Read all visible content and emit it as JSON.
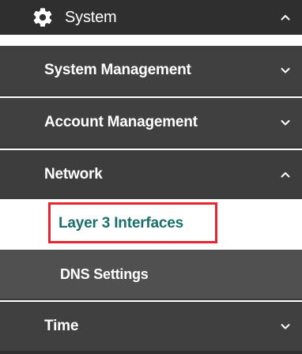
{
  "menu": {
    "system": {
      "label": "System",
      "icon": "gear-icon",
      "expanded": true
    },
    "items": [
      {
        "label": "System Management",
        "expanded": false
      },
      {
        "label": "Account Management",
        "expanded": false
      },
      {
        "label": "Network",
        "expanded": true
      },
      {
        "label": "Time",
        "expanded": false
      }
    ],
    "network_children": [
      {
        "label": "Layer 3 Interfaces",
        "selected": true
      },
      {
        "label": "DNS Settings",
        "selected": false
      }
    ]
  },
  "colors": {
    "header_bg": "#2f2f2f",
    "item_bg": "#404040",
    "subitem_bg": "#505050",
    "selected_bg": "#ffffff",
    "selected_text": "#1a6f6c",
    "highlight_border": "#e8262f",
    "text": "#ffffff"
  }
}
